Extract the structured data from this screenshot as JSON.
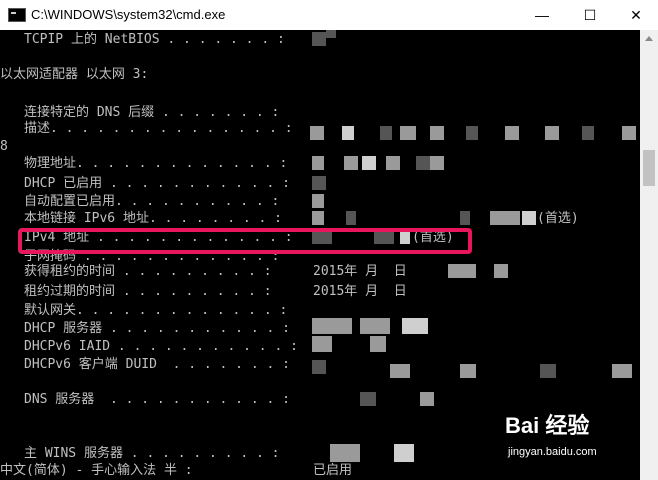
{
  "window": {
    "title": "C:\\WINDOWS\\system32\\cmd.exe",
    "minimize": "—",
    "maximize": "☐",
    "close": "✕"
  },
  "console": {
    "top_label": "TCPIP 上的 NetBIOS . . . . . . . :",
    "adapter_header": "以太网适配器 以太网 3:",
    "dns_suffix": "连接特定的 DNS 后缀 . . . . . . . :",
    "description": "描述. . . . . . . . . . . . . . . :",
    "wrap_char": "8",
    "physical": "物理地址. . . . . . . . . . . . . :",
    "dhcp_enabled": "DHCP 已启用 . . . . . . . . . . . :",
    "autoconf": "自动配置已启用. . . . . . . . . . :",
    "ipv6": "本地链接 IPv6 地址. . . . . . . . :",
    "ipv6_suffix": "(首选)",
    "ipv4": "IPv4 地址 . . . . . . . . . . . . :",
    "ipv4_suffix": "(首选)",
    "subnet": "子网掩码 . . . . . . . . . . . . :",
    "lease_obtained": "获得租约的时间 . . . . . . . . . :",
    "lease_obtained_val": "2015年 月  日",
    "lease_expires": "租约过期的时间 . . . . . . . . . :",
    "lease_expires_val": "2015年 月  日",
    "gateway": "默认网关. . . . . . . . . . . . . :",
    "dhcp_server": "DHCP 服务器 . . . . . . . . . . . :",
    "iaid": "DHCPv6 IAID . . . . . . . . . . . :",
    "duid": "DHCPv6 客户端 DUID  . . . . . . . :",
    "dns_servers": "DNS 服务器  . . . . . . . . . . . :",
    "wins": "主 WINS 服务器 . . . . . . . . . :",
    "ime_status": "中文(简体) - 手心输入法 半 :",
    "ime_value": "已启用"
  },
  "watermark": {
    "brand": "Bai  经验",
    "site": "jingyan.baidu.com"
  },
  "colors": {
    "highlight": "#e8175d",
    "console_bg": "#000000",
    "console_text": "#c0c0c0"
  }
}
